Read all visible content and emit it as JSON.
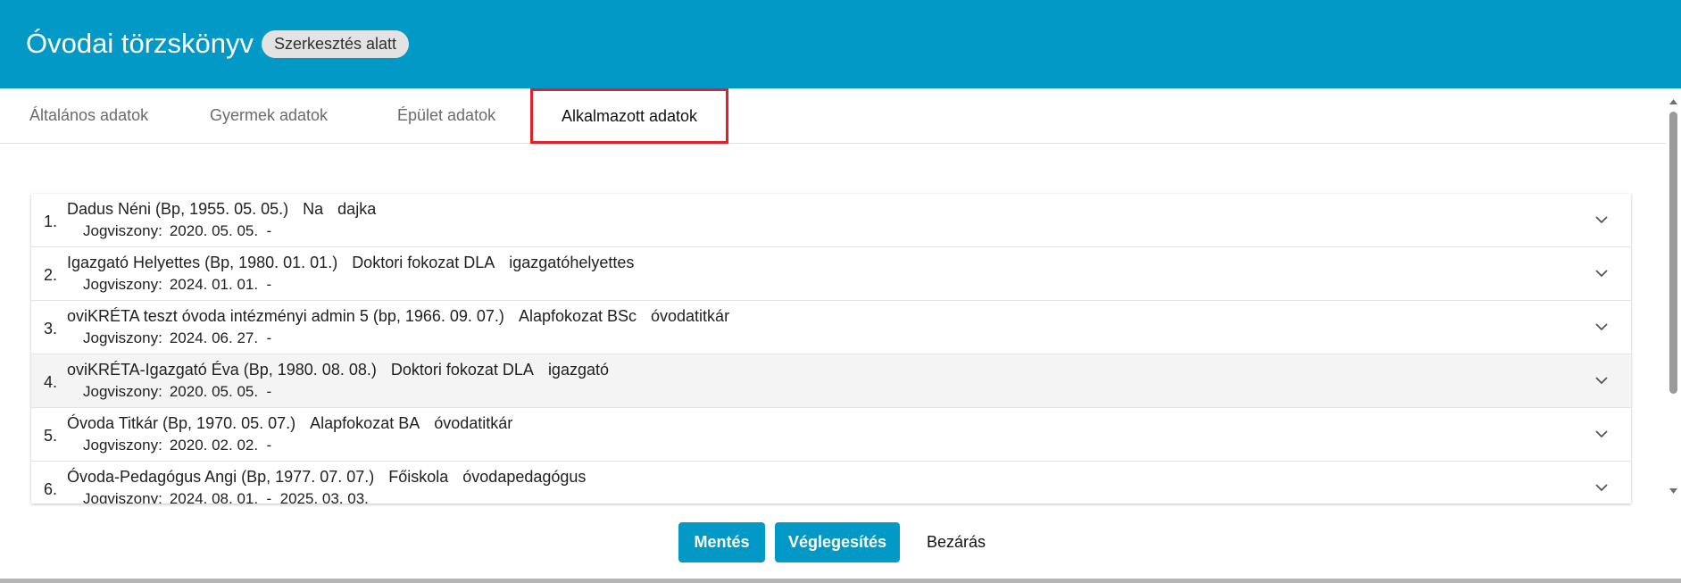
{
  "header": {
    "title": "Óvodai törzskönyv",
    "status_badge": "Szerkesztés alatt",
    "accent_color": "#0399c6"
  },
  "tabs": [
    {
      "label": "Általános adatok",
      "active": false
    },
    {
      "label": "Gyermek adatok",
      "active": false
    },
    {
      "label": "Épület adatok",
      "active": false
    },
    {
      "label": "Alkalmazott adatok",
      "active": true
    }
  ],
  "employees": [
    {
      "num": "1.",
      "name": "Dadus Néni (Bp, 1955. 05. 05.)",
      "degree": "Na",
      "role": "dajka",
      "employment_label": "Jogviszony:",
      "employment": "2020. 05. 05.  -"
    },
    {
      "num": "2.",
      "name": "Igazgató Helyettes (Bp, 1980. 01. 01.)",
      "degree": "Doktori fokozat DLA",
      "role": "igazgatóhelyettes",
      "employment_label": "Jogviszony:",
      "employment": "2024. 01. 01.  -"
    },
    {
      "num": "3.",
      "name": "oviKRÉTA teszt óvoda intézményi admin 5 (bp, 1966. 09. 07.)",
      "degree": "Alapfokozat BSc",
      "role": "óvodatitkár",
      "employment_label": "Jogviszony:",
      "employment": "2024. 06. 27.  -"
    },
    {
      "num": "4.",
      "name": "oviKRÉTA-Igazgató Éva (Bp, 1980. 08. 08.)",
      "degree": "Doktori fokozat DLA",
      "role": "igazgató",
      "employment_label": "Jogviszony:",
      "employment": "2020. 05. 05.  -"
    },
    {
      "num": "5.",
      "name": "Óvoda Titkár (Bp, 1970. 05. 07.)",
      "degree": "Alapfokozat BA",
      "role": "óvodatitkár",
      "employment_label": "Jogviszony:",
      "employment": "2020. 02. 02.  -"
    },
    {
      "num": "6.",
      "name": "Óvoda-Pedagógus Angi (Bp, 1977. 07. 07.)",
      "degree": "Főiskola",
      "role": "óvodapedagógus",
      "employment_label": "Jogviszony:",
      "employment": "2024. 08. 01.  -  2025. 03. 03."
    }
  ],
  "footer": {
    "save_label": "Mentés",
    "finalize_label": "Véglegesítés",
    "close_label": "Bezárás"
  }
}
